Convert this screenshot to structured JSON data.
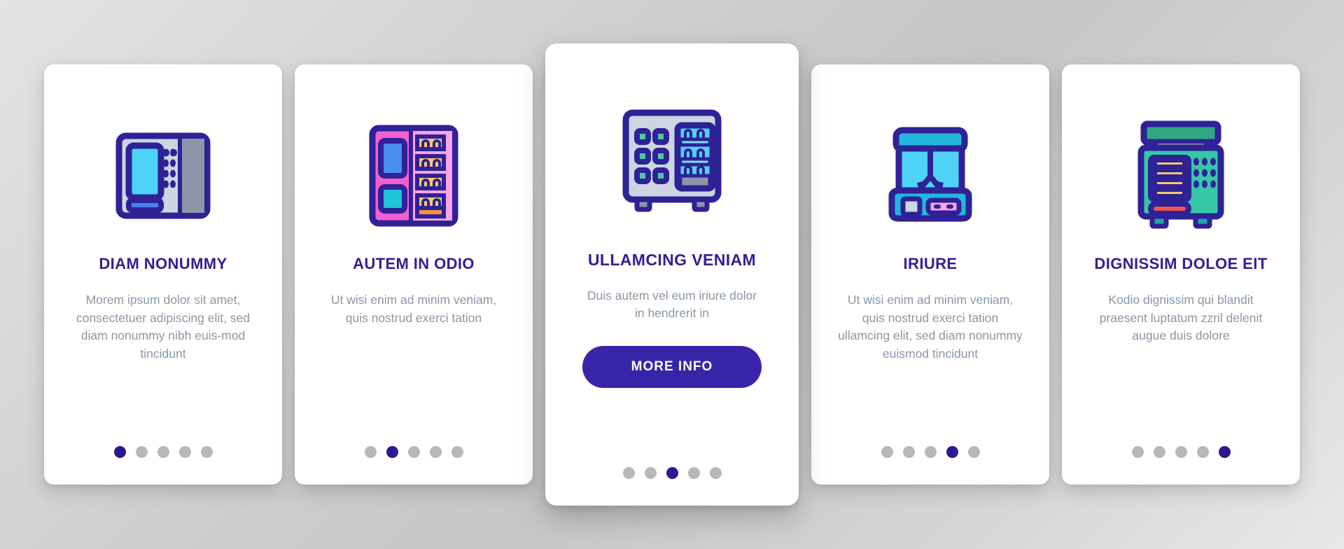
{
  "theme": {
    "accent": "#2f2196",
    "accent_button": "#3626a7",
    "body_text": "#8a97a4",
    "dot_inactive": "#b8b8b8",
    "dot_active": "#2b1a8e",
    "card_background": "#ffffff",
    "page_background": "#cfcfcf"
  },
  "screens": [
    {
      "id": "screen-1",
      "icon": "vending-machine-payphone-icon",
      "featured": false,
      "title": "DIAM NONUMMY",
      "body": "Morem ipsum dolor sit amet, consectetuer adipiscing elit, sed diam nonummy nibh euis-mod tincidunt",
      "cta": null,
      "dots": {
        "count": 5,
        "active_index": 0
      }
    },
    {
      "id": "screen-2",
      "icon": "vending-machine-pink-icon",
      "featured": false,
      "title": "AUTEM IN ODIO",
      "body": "Ut wisi enim ad minim veniam, quis nostrud exerci tation",
      "cta": null,
      "dots": {
        "count": 5,
        "active_index": 1
      }
    },
    {
      "id": "screen-3",
      "icon": "vending-machine-drinks-icon",
      "featured": true,
      "title": "ULLAMCING VENIAM",
      "body": "Duis autem vel eum iriure dolor in hendrerit in",
      "cta": "MORE INFO",
      "dots": {
        "count": 5,
        "active_index": 2
      }
    },
    {
      "id": "screen-4",
      "icon": "claw-machine-icon",
      "featured": false,
      "title": "IRIURE",
      "body": "Ut wisi enim ad minim veniam, quis nostrud exerci tation ullamcing elit, sed diam nonummy euismod tincidunt",
      "cta": null,
      "dots": {
        "count": 5,
        "active_index": 3
      }
    },
    {
      "id": "screen-5",
      "icon": "vending-machine-green-icon",
      "featured": false,
      "title": "DIGNISSIM DOLOE EIT",
      "body": "Kodio dignissim qui blandit praesent luptatum zzril delenit augue duis dolore",
      "cta": null,
      "dots": {
        "count": 5,
        "active_index": 4
      }
    }
  ]
}
